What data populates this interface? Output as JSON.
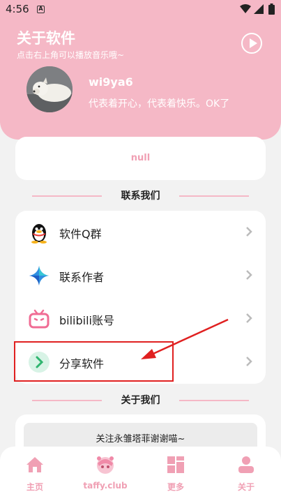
{
  "status_bar": {
    "time": "4:56",
    "notification_icon": "A"
  },
  "header": {
    "title": "关于软件",
    "subtitle": "点击右上角可以播放音乐哦~",
    "username": "wi9ya6",
    "motto": "代表着开心，代表着快乐。OK了"
  },
  "null_card": {
    "text": "null"
  },
  "contact_section": {
    "title": "联系我们",
    "items": [
      {
        "label": "软件Q群",
        "icon": "qq-penguin-icon"
      },
      {
        "label": "联系作者",
        "icon": "sparkle-icon"
      },
      {
        "label": "bilibili账号",
        "icon": "bilibili-tv-icon"
      },
      {
        "label": "分享软件",
        "icon": "share-chevron-icon"
      }
    ]
  },
  "about_section": {
    "title": "关于我们",
    "text": "关注永雏塔菲谢谢喵~"
  },
  "bottom_nav": {
    "items": [
      {
        "label": "主页",
        "icon": "home-icon"
      },
      {
        "label": "taffy.club",
        "icon": "taffy-avatar-icon"
      },
      {
        "label": "更多",
        "icon": "grid-icon"
      },
      {
        "label": "关于",
        "icon": "user-icon"
      }
    ]
  },
  "colors": {
    "accent_pink": "#f5b8c6",
    "highlight_red": "#e02020"
  }
}
